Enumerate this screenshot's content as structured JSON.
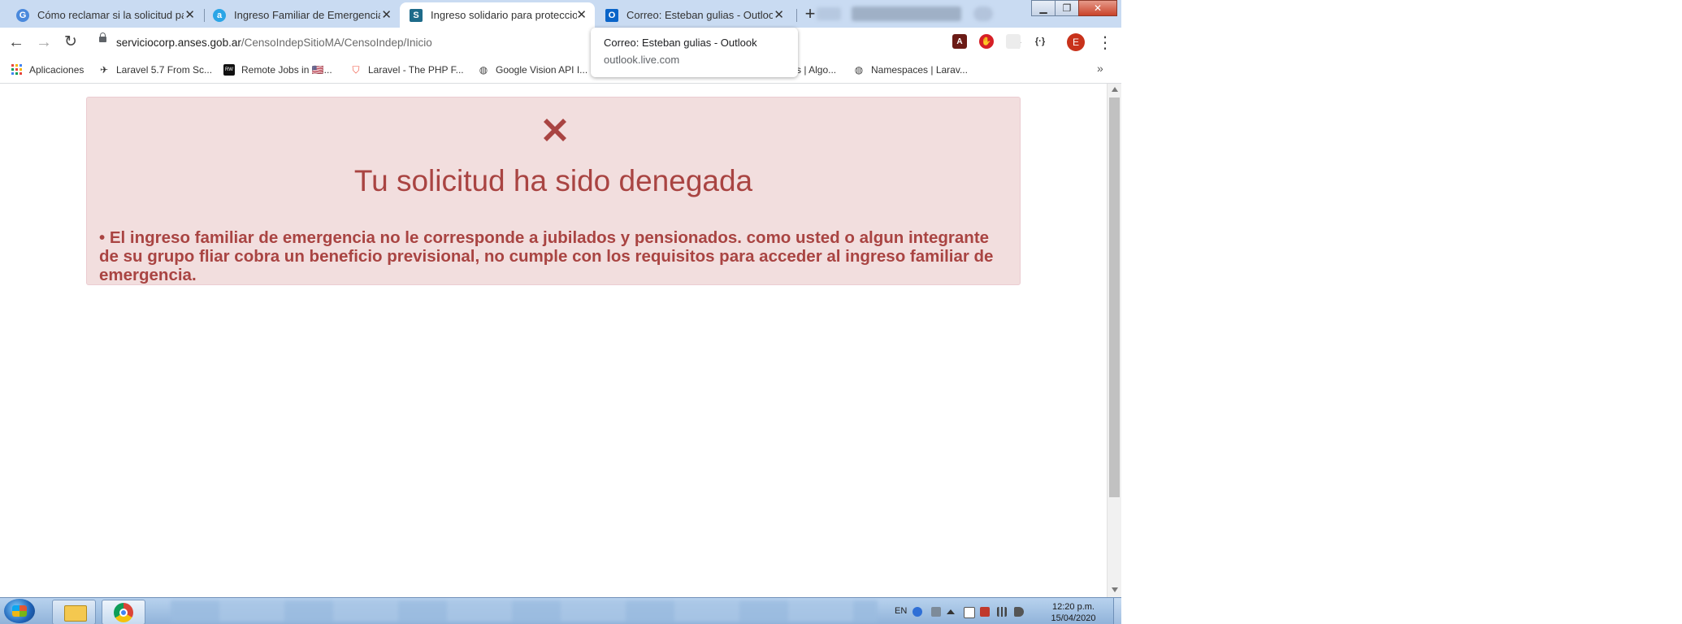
{
  "browser": {
    "tabs": [
      {
        "title": "Cómo reclamar si la solicitud para",
        "favicon_color": "#4a89dc",
        "favicon_letter": "G",
        "active": false
      },
      {
        "title": "Ingreso Familiar de Emergencia |",
        "favicon_color": "#2aa5e6",
        "favicon_letter": "a",
        "active": false
      },
      {
        "title": "Ingreso solidario para proteccion",
        "favicon_color": "#1e6b8a",
        "favicon_letter": "S",
        "active": true
      },
      {
        "title": "Correo: Esteban gulias - Outlook",
        "favicon_color": "#0a64c8",
        "favicon_letter": "O",
        "active": false
      }
    ],
    "tab_close_glyph": "✕",
    "new_tab_glyph": "+",
    "url_domain": "serviciocorp.anses.gob.ar",
    "url_path": "/CensoIndepSitioMA/CensoIndep/Inicio",
    "avatar_letter": "E",
    "tooltip": {
      "title": "Correo: Esteban gulias - Outlook",
      "url": "outlook.live.com"
    },
    "bookmarks": [
      {
        "label": "Aplicaciones",
        "icon": "apps-grid-icon"
      },
      {
        "label": "Laravel 5.7 From Sc...",
        "icon": "paper-plane-icon"
      },
      {
        "label": "Remote Jobs in 🇺🇸...",
        "icon": "rw-logo-icon"
      },
      {
        "label": "Laravel - The PHP F...",
        "icon": "laravel-icon"
      },
      {
        "label": "Google Vision API I...",
        "icon": "globe-icon"
      },
      {
        "label": "s | Algo...",
        "icon": "none"
      },
      {
        "label": "Namespaces | Larav...",
        "icon": "globe-icon"
      }
    ],
    "bookmarks_overflow": "»"
  },
  "page": {
    "alert": {
      "icon": "x-icon",
      "title": "Tu solicitud ha sido denegada",
      "message": "• El ingreso familiar de emergencia no le corresponde a jubilados y pensionados. como usted o algun integrante  de su grupo fliar cobra un beneficio previsional,  no cumple con los requisitos para acceder al ingreso familiar de emergencia.",
      "text_color": "#a94442",
      "bg_color": "#f2dede",
      "border_color": "#ebccd1"
    }
  },
  "taskbar": {
    "language": "EN",
    "time": "12:20 p.m.",
    "date": "15/04/2020"
  }
}
